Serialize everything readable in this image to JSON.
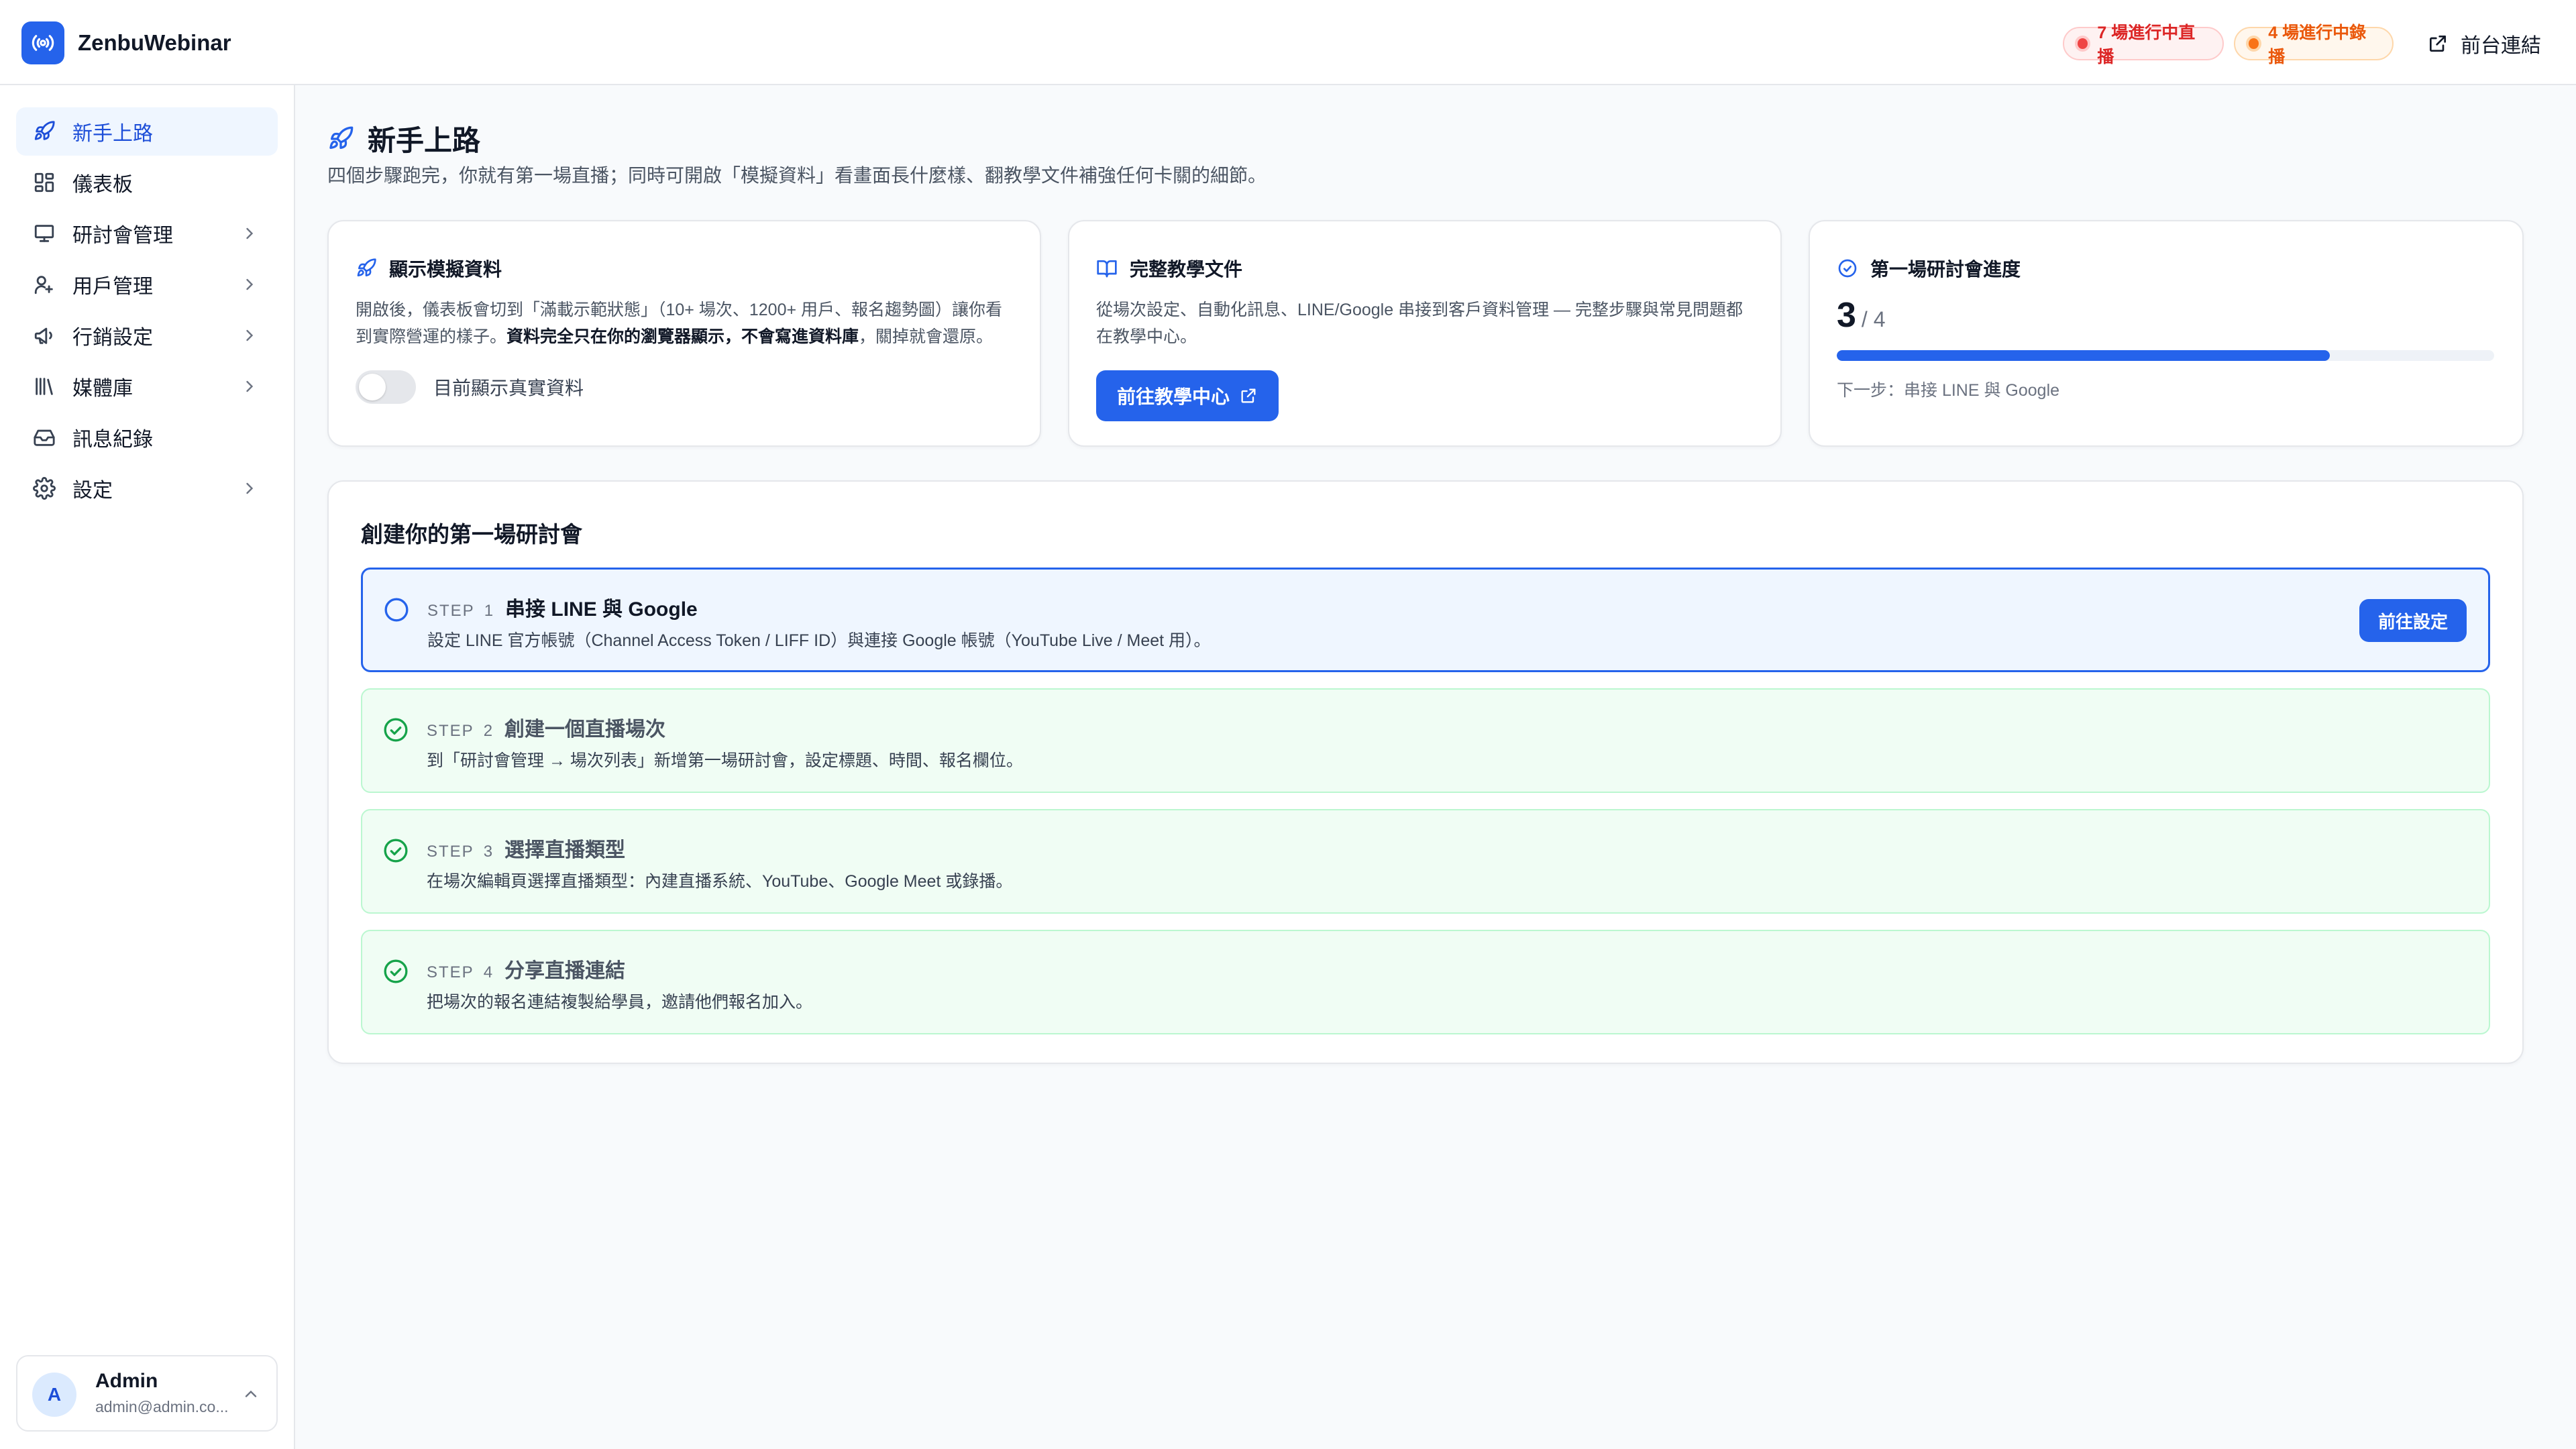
{
  "app": {
    "brand": "ZenbuWebinar"
  },
  "header": {
    "live_badge": "7 場進行中直播",
    "recording_badge": "4 場進行中錄播",
    "front_link": "前台連結"
  },
  "sidebar": {
    "items": [
      {
        "label": "新手上路",
        "icon": "rocket-icon",
        "active": true
      },
      {
        "label": "儀表板",
        "icon": "dashboard-icon"
      },
      {
        "label": "研討會管理",
        "icon": "presentation-icon",
        "chevron": true
      },
      {
        "label": "用戶管理",
        "icon": "users-icon",
        "chevron": true
      },
      {
        "label": "行銷設定",
        "icon": "megaphone-icon",
        "chevron": true
      },
      {
        "label": "媒體庫",
        "icon": "library-icon",
        "chevron": true
      },
      {
        "label": "訊息紀錄",
        "icon": "inbox-icon"
      },
      {
        "label": "設定",
        "icon": "gear-icon",
        "chevron": true
      }
    ],
    "user": {
      "initial": "A",
      "name": "Admin",
      "email": "admin@admin.co..."
    }
  },
  "page": {
    "title": "新手上路",
    "subtitle": "四個步驟跑完，你就有第一場直播；同時可開啟「模擬資料」看畫面長什麼樣、翻教學文件補強任何卡關的細節。"
  },
  "cards": {
    "mock": {
      "title": "顯示模擬資料",
      "body_1": "開啟後，儀表板會切到「滿載示範狀態」（10+ 場次、1200+ 用戶、報名趨勢圖）讓你看到實際營運的樣子。",
      "body_bold": "資料完全只在你的瀏覽器顯示，不會寫進資料庫",
      "body_2": "，關掉就會還原。",
      "toggle_label": "目前顯示真實資料",
      "toggle_on": false
    },
    "docs": {
      "title": "完整教學文件",
      "body": "從場次設定、自動化訊息、LINE/Google 串接到客戶資料管理 — 完整步驟與常見問題都在教學中心。",
      "button": "前往教學中心"
    },
    "progress": {
      "title": "第一場研討會進度",
      "done": "3",
      "total": "/ 4",
      "fraction": 0.75,
      "next": "下一步：串接 LINE 與 Google"
    }
  },
  "steps_section": {
    "title": "創建你的第一場研討會",
    "step_word": "STEP",
    "steps": [
      {
        "num": "1",
        "title": "串接 LINE 與 Google",
        "desc": "設定 LINE 官方帳號（Channel Access Token / LIFF ID）與連接 Google 帳號（YouTube Live / Meet 用）。",
        "status": "current",
        "button": "前往設定"
      },
      {
        "num": "2",
        "title": "創建一個直播場次",
        "desc": "到「研討會管理 → 場次列表」新增第一場研討會，設定標題、時間、報名欄位。",
        "status": "done"
      },
      {
        "num": "3",
        "title": "選擇直播類型",
        "desc": "在場次編輯頁選擇直播類型：內建直播系統、YouTube、Google Meet 或錄播。",
        "status": "done"
      },
      {
        "num": "4",
        "title": "分享直播連結",
        "desc": "把場次的報名連結複製給學員，邀請他們報名加入。",
        "status": "done"
      }
    ]
  },
  "colors": {
    "accent": "#2563eb",
    "live": "#dc2626",
    "recording": "#ea580c",
    "success": "#16a34a"
  }
}
